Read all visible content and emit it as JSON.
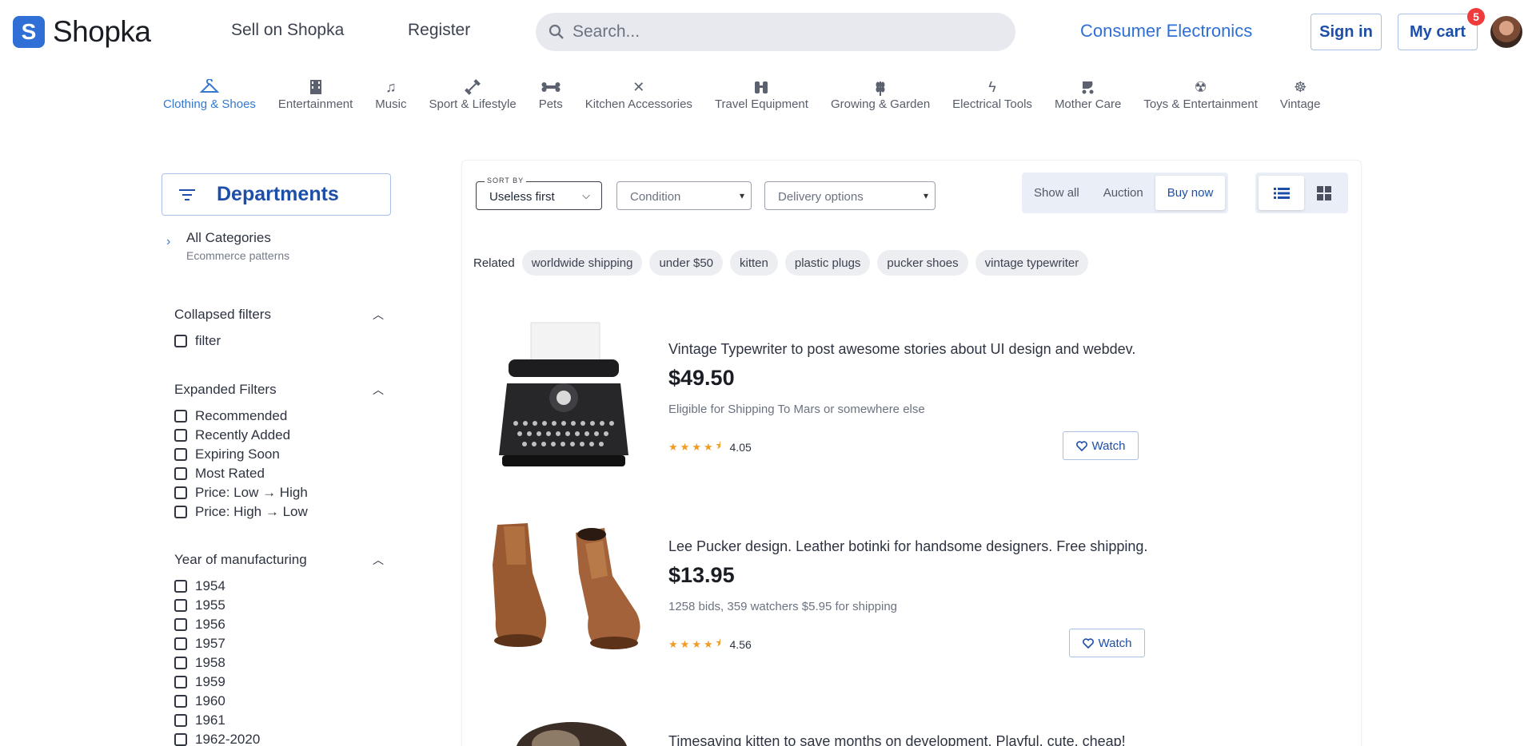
{
  "header": {
    "logo_letter": "S",
    "logo_text": "Shopka",
    "sell_link": "Sell on Shopka",
    "register_link": "Register",
    "search_placeholder": "Search...",
    "category_link": "Consumer Electronics",
    "signin_label": "Sign in",
    "cart_label": "My cart",
    "cart_count": "5"
  },
  "categories": [
    {
      "label": "Clothing & Shoes",
      "icon": "hanger-icon",
      "active": true
    },
    {
      "label": "Entertainment",
      "icon": "film-icon"
    },
    {
      "label": "Music",
      "icon": "music-note-icon"
    },
    {
      "label": "Sport & Lifestyle",
      "icon": "dumbbell-icon"
    },
    {
      "label": "Pets",
      "icon": "bone-icon"
    },
    {
      "label": "Kitchen Accessories",
      "icon": "utensils-icon"
    },
    {
      "label": "Travel Equipment",
      "icon": "binoculars-icon"
    },
    {
      "label": "Growing & Garden",
      "icon": "wheat-icon"
    },
    {
      "label": "Electrical Tools",
      "icon": "plug-icon"
    },
    {
      "label": "Mother Care",
      "icon": "stroller-icon"
    },
    {
      "label": "Toys & Entertainment",
      "icon": "radiation-icon"
    },
    {
      "label": "Vintage",
      "icon": "ship-wheel-icon"
    }
  ],
  "sidebar": {
    "departments_label": "Departments",
    "all_categories": "All Categories",
    "all_categories_sub": "Ecommerce patterns",
    "groups": [
      {
        "title": "Collapsed filters",
        "items": [
          "filter"
        ]
      },
      {
        "title": "Expanded Filters",
        "items": [
          "Recommended",
          "Recently Added",
          "Expiring Soon",
          "Most Rated",
          "Price: Low → High",
          "Price: High → Low"
        ]
      },
      {
        "title": "Year of manufacturing",
        "items": [
          "1954",
          "1955",
          "1956",
          "1957",
          "1958",
          "1959",
          "1960",
          "1961",
          "1962-2020"
        ]
      }
    ]
  },
  "toolbar": {
    "sort_label": "SORT BY",
    "sort_value": "Useless first",
    "condition_placeholder": "Condition",
    "delivery_placeholder": "Delivery options",
    "segments": [
      "Show all",
      "Auction",
      "Buy now"
    ],
    "active_segment": "Buy now"
  },
  "related": {
    "label": "Related",
    "chips": [
      "worldwide shipping",
      "under $50",
      "kitten",
      "plastic plugs",
      "pucker shoes",
      "vintage typewriter"
    ]
  },
  "products": [
    {
      "title": "Vintage Typewriter to post awesome stories about UI design and webdev.",
      "price": "$49.50",
      "meta": "Eligible for Shipping To Mars or somewhere else",
      "rating": "4.05",
      "stars": 4.05,
      "watch_label": "Watch"
    },
    {
      "title": "Lee Pucker design. Leather botinki for handsome designers. Free shipping.",
      "price": "$13.95",
      "meta": "1258 bids, 359 watchers $5.95 for shipping",
      "rating": "4.56",
      "stars": 4.56,
      "watch_label": "Watch"
    },
    {
      "title": "Timesaving kitten to save months on development. Playful, cute, cheap!"
    }
  ],
  "colors": {
    "accent": "#2f6fd6",
    "star": "#f29a22",
    "badge": "#ef3b3b"
  }
}
